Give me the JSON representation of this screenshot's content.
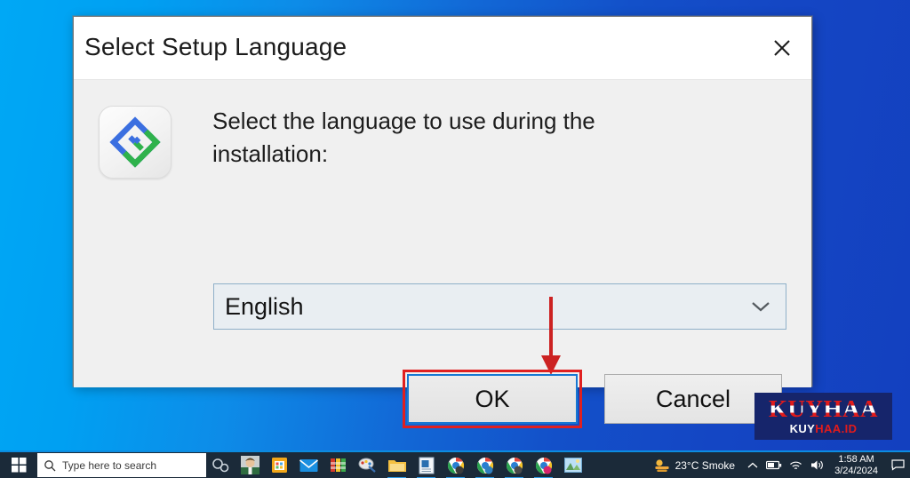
{
  "desktop": {
    "wallpaper_left_color": "#00a8f5",
    "wallpaper_right_color": "#1340bf"
  },
  "dialog": {
    "title": "Select Setup Language",
    "close_label": "Close",
    "icon_name": "setup-app-logo",
    "prompt": "Select the language to use during the installation:",
    "language_select": {
      "value": "English",
      "options": [
        "English"
      ]
    },
    "buttons": {
      "ok": "OK",
      "cancel": "Cancel"
    },
    "annotations": {
      "arrow_color": "#cc2222",
      "highlight_color": "#e02020",
      "focus_color": "#1878d2"
    }
  },
  "watermark": {
    "main": "KUYHAA",
    "sub_part1": "KUY",
    "sub_part2": "HAA",
    "sub_part3": ".ID",
    "background_color": "#16256b"
  },
  "taskbar": {
    "start_label": "Start",
    "search": {
      "placeholder": "Type here to search"
    },
    "pinned": [
      {
        "name": "cortana-icon",
        "label": "Cortana"
      },
      {
        "name": "user-photo-icon",
        "label": "People"
      },
      {
        "name": "microsoft-store-icon",
        "label": "Microsoft Store"
      },
      {
        "name": "mail-icon",
        "label": "Mail"
      },
      {
        "name": "winrar-icon",
        "label": "WinRAR"
      },
      {
        "name": "paint-icon",
        "label": "Paint"
      },
      {
        "name": "file-explorer-icon",
        "label": "File Explorer"
      },
      {
        "name": "document-icon",
        "label": "Document"
      },
      {
        "name": "chrome-icon-1",
        "label": "Google Chrome"
      },
      {
        "name": "chrome-icon-2",
        "label": "Google Chrome"
      },
      {
        "name": "chrome-icon-3",
        "label": "Google Chrome"
      },
      {
        "name": "chrome-icon-4",
        "label": "Google Chrome"
      },
      {
        "name": "photo-viewer-icon",
        "label": "Photos"
      }
    ],
    "weather": {
      "temperature": "23°C",
      "condition": "Smoke",
      "display": "23°C  Smoke"
    },
    "tray": [
      {
        "name": "show-hidden-icons-icon"
      },
      {
        "name": "battery-icon"
      },
      {
        "name": "network-icon"
      },
      {
        "name": "volume-icon"
      }
    ],
    "clock": {
      "time": "1:58 AM",
      "date": "3/24/2024"
    },
    "notification_label": "Notifications"
  }
}
